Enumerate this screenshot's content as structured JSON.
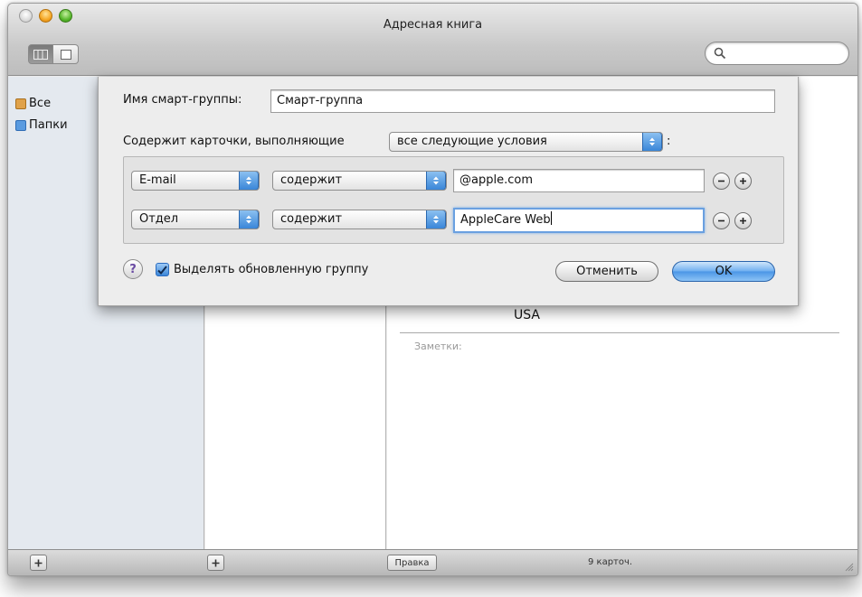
{
  "window": {
    "title": "Адресная книга"
  },
  "groups": {
    "items": [
      {
        "label": "Все",
        "icon": "address-book-icon",
        "color": "#e0a24a"
      },
      {
        "label": "Папки",
        "icon": "folder-icon",
        "color": "#5a9be0"
      }
    ]
  },
  "card": {
    "country": "USA",
    "notes_label": "Заметки:"
  },
  "bottom": {
    "edit_label": "Правка",
    "status": "9 карточ."
  },
  "sheet": {
    "name_label": "Имя смарт-группы:",
    "name_value": "Смарт-группа",
    "contains_label": "Содержит карточки, выполняющие",
    "match_value": "все следующие условия",
    "match_suffix": ":",
    "rules": [
      {
        "field": "E-mail",
        "operator": "содержит",
        "value": "@apple.com"
      },
      {
        "field": "Отдел",
        "operator": "содержит",
        "value": "AppleCare Web"
      }
    ],
    "help_label": "?",
    "highlight_label": "Выделять обновленную группу",
    "highlight_checked": true,
    "cancel_label": "Отменить",
    "ok_label": "OK"
  },
  "colors": {
    "accent": "#3a86d8",
    "focus_ring": "#6aa0e0"
  }
}
